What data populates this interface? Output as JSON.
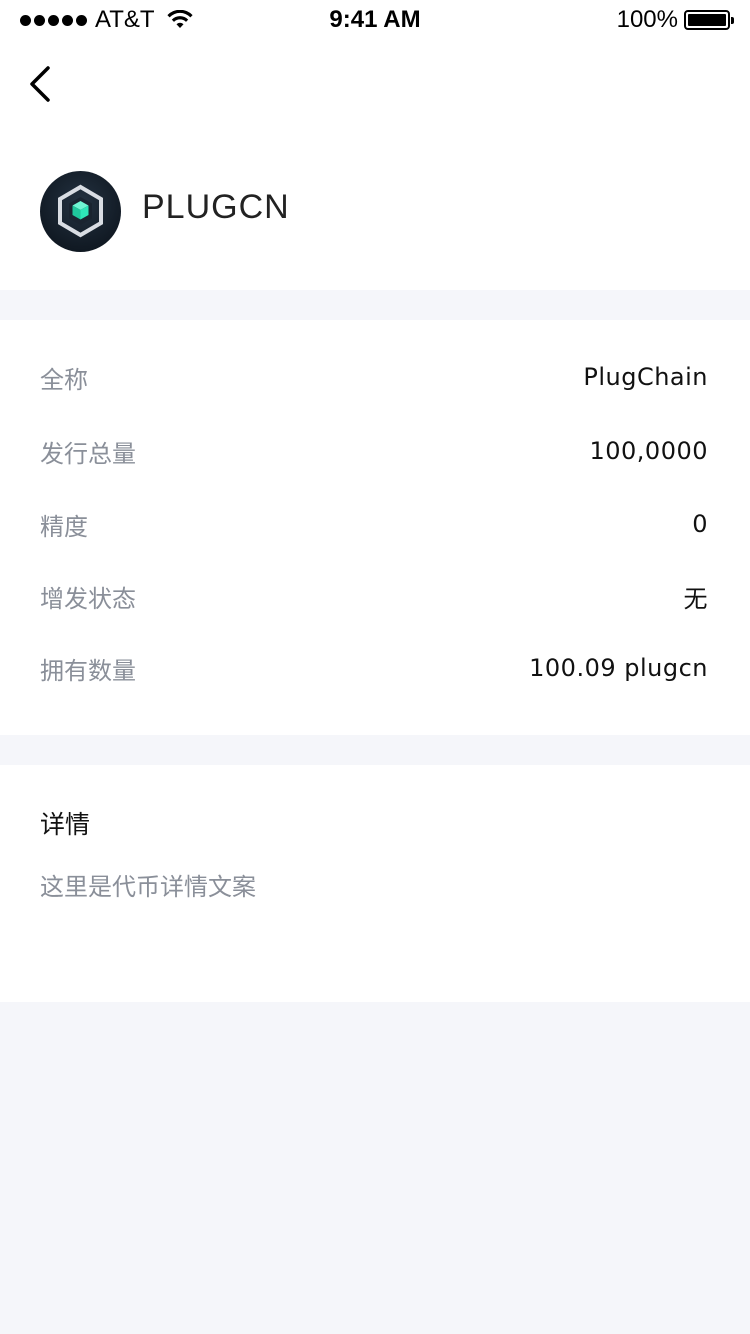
{
  "status_bar": {
    "carrier": "AT&T",
    "time": "9:41 AM",
    "battery": "100%",
    "signal_bars": 5,
    "icons": {
      "wifi": "wifi-icon",
      "battery": "battery-icon"
    }
  },
  "header": {
    "back_icon": "chevron-left-icon",
    "token_logo_icon": "hexagon-cube-icon",
    "token_symbol": "PLUGCN"
  },
  "info": {
    "rows": [
      {
        "label": "全称",
        "value": "PlugChain"
      },
      {
        "label": "发行总量",
        "value": "100,0000"
      },
      {
        "label": "精度",
        "value": "0"
      },
      {
        "label": "增发状态",
        "value": "无"
      },
      {
        "label": "拥有数量",
        "value": "100.09 plugcn"
      }
    ]
  },
  "details": {
    "title": "详情",
    "text": "这里是代币详情文案"
  },
  "colors": {
    "background": "#f5f6fa",
    "card": "#ffffff",
    "label": "#8a8f99",
    "logo_accent": "#2ee6b8"
  }
}
